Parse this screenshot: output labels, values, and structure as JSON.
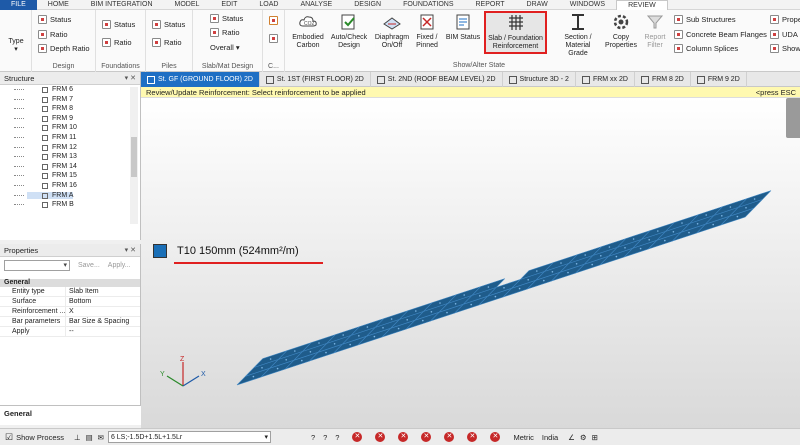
{
  "menu": [
    "FILE",
    "HOME",
    "BIM INTEGRATION",
    "MODEL",
    "EDIT",
    "LOAD",
    "ANALYSE",
    "DESIGN",
    "FOUNDATIONS",
    "REPORT",
    "DRAW",
    "WINDOWS",
    "REVIEW"
  ],
  "ribbon": {
    "type_label": "Type",
    "design": {
      "label": "Design",
      "status": "Status",
      "ratio": "Ratio",
      "depth_ratio": "Depth Ratio"
    },
    "foundations": {
      "label": "Foundations",
      "status": "Status",
      "ratio": "Ratio"
    },
    "piles": {
      "label": "Piles",
      "status": "Status",
      "ratio": "Ratio"
    },
    "slabmat": {
      "label": "Slab/Mat Design",
      "status": "Status",
      "ratio": "Ratio",
      "overall": "Overall"
    },
    "c_label": "C...",
    "embodied": "Embodied Carbon",
    "autocheck": "Auto/Check Design",
    "diaphragm": "Diaphragm On/Off",
    "fixed": "Fixed / Pinned",
    "bimstatus": "BIM Status",
    "slabfound": "Slab / Foundation Reinforcement",
    "section": "Section / Material Grade",
    "copy": "Copy Properties",
    "reportfilter": "Report Filter",
    "showalter": "Show/Alter State",
    "sub_structures": "Sub Structures",
    "concrete_beam": "Concrete Beam Flanges",
    "column_splices": "Column Splices",
    "prope": "Prope",
    "uda": "UDA",
    "show": "Show/"
  },
  "tabs": [
    "St. GF (GROUND FLOOR) 2D",
    "St. 1ST (FIRST FLOOR) 2D",
    "St. 2ND (ROOF BEAM LEVEL) 2D",
    "Structure 3D - 2",
    "FRM xx 2D",
    "FRM 8 2D",
    "FRM 9 2D"
  ],
  "status_message": "Review/Update Reinforcement: Select reinforcement to be applied",
  "status_esc": "<press ESC",
  "structure": {
    "title": "Structure",
    "btns": "▾ ✕",
    "items": [
      "FRM 6",
      "FRM 7",
      "FRM 8",
      "FRM 9",
      "FRM 10",
      "FRM 11",
      "FRM 12",
      "FRM 13",
      "FRM 14",
      "FRM 15",
      "FRM 16",
      "FRM A",
      "FRM B"
    ],
    "selected_index": 11
  },
  "properties": {
    "title": "Properties",
    "btns": "▾ ✕",
    "save": "Save...",
    "apply_btn": "Apply...",
    "group": "General",
    "rows": [
      {
        "k": "Entity type",
        "v": "Slab Item"
      },
      {
        "k": "Surface",
        "v": "Bottom"
      },
      {
        "k": "Reinforcement ...",
        "v": "X"
      },
      {
        "k": "Bar parameters",
        "v": "Bar Size & Spacing"
      },
      {
        "k": "Apply",
        "v": "--"
      }
    ],
    "bottom_label": "General"
  },
  "legend_text": "T10 150mm (524mm²/m)",
  "bottom": {
    "show_process": "Show Process",
    "combo": "6 LS;-1.5D+1.5L+1.5Lr",
    "metric": "Metric",
    "region": "India"
  },
  "colors": {
    "slab": "#1f5c8b",
    "accent": "#1e6fc4",
    "highlight": "#e02020"
  }
}
